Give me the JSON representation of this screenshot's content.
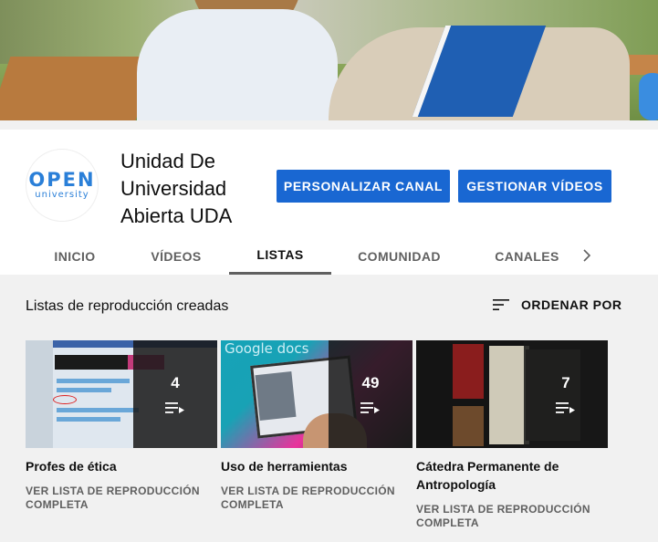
{
  "channel": {
    "name": "Unidad De Universidad Abierta UDA",
    "avatar_line1": "OPEN",
    "avatar_line2": "university"
  },
  "buttons": {
    "customize": "PERSONALIZAR CANAL",
    "manage": "GESTIONAR VÍDEOS"
  },
  "tabs": [
    {
      "label": "INICIO",
      "active": false
    },
    {
      "label": "VÍDEOS",
      "active": false
    },
    {
      "label": "LISTAS",
      "active": true
    },
    {
      "label": "COMUNIDAD",
      "active": false
    },
    {
      "label": "CANALES",
      "active": false
    }
  ],
  "section": {
    "title": "Listas de reproducción creadas",
    "sort_label": "ORDENAR POR"
  },
  "playlists": [
    {
      "title": "Profes de ética",
      "count": "4",
      "link": "VER LISTA DE REPRODUCCIÓN COMPLETA"
    },
    {
      "title": "Uso de herramientas",
      "count": "49",
      "link": "VER LISTA DE REPRODUCCIÓN COMPLETA",
      "thumb_text": "Google docs"
    },
    {
      "title": "Cátedra Permanente de Antropología",
      "count": "7",
      "link": "VER LISTA DE REPRODUCCIÓN COMPLETA"
    }
  ],
  "colors": {
    "accent": "#1967d2",
    "tab_underline": "#606060",
    "background": "#f1f1f1"
  },
  "icons": {
    "sort": "sort-lines-icon",
    "playlist": "playlist-play-icon",
    "tabs_next": "chevron-right-icon"
  }
}
